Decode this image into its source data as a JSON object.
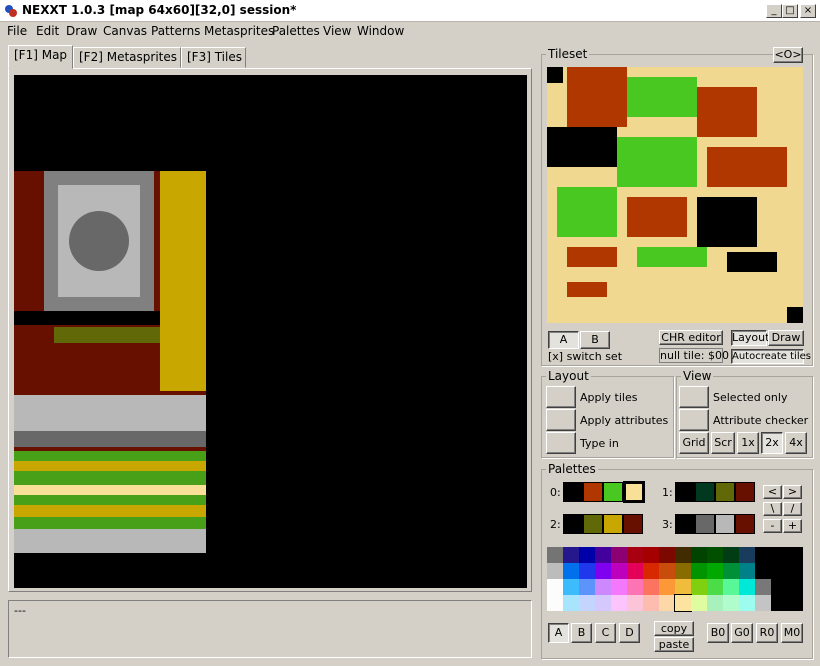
{
  "titlebar": {
    "title": "NEXXT 1.0.3  [map 64x60][32,0] session*",
    "minimize": "_",
    "maximize": "□",
    "close": "×"
  },
  "menu": [
    "File",
    "Edit",
    "Draw",
    "Canvas",
    "Patterns",
    "Metasprites",
    "Palettes",
    "View",
    "Window"
  ],
  "tabs": [
    "[F1] Map",
    "[F2] Metasprites",
    "[F3] Tiles"
  ],
  "status": {
    "text": "---"
  },
  "tileset": {
    "label": "Tileset",
    "toggle": "<O>",
    "bank_a": "A",
    "bank_b": "B",
    "switch_set": "[x] switch set",
    "chr_editor": "CHR editor",
    "null_tile": "null tile: $00",
    "layout": "Layout",
    "draw": "Draw",
    "autocreate": "Autocreate tiles"
  },
  "layout_group": {
    "label": "Layout",
    "apply_tiles": "Apply tiles",
    "apply_attributes": "Apply attributes",
    "type_in": "Type in"
  },
  "view_group": {
    "label": "View",
    "selected_only": "Selected only",
    "attribute_checker": "Attribute checker",
    "grid": "Grid",
    "scr": "Scr",
    "z1": "1x",
    "z2": "2x",
    "z4": "4x"
  },
  "palettes": {
    "label": "Palettes",
    "rows": [
      {
        "label": "0:",
        "colors": [
          "#000000",
          "#b03800",
          "#48c820",
          "#f8e098"
        ]
      },
      {
        "label": "1:",
        "colors": [
          "#000000",
          "#003820",
          "#606808",
          "#681000"
        ]
      },
      {
        "label": "2:",
        "colors": [
          "#000000",
          "#606808",
          "#c8a800",
          "#681000"
        ]
      },
      {
        "label": "3:",
        "colors": [
          "#000000",
          "#686868",
          "#b8b8b8",
          "#681000"
        ]
      }
    ],
    "nav": [
      "<",
      ">",
      "\\",
      "/",
      "-",
      "+"
    ],
    "subpal": [
      "A",
      "B",
      "C",
      "D"
    ],
    "copy": "copy",
    "paste": "paste",
    "regs": [
      "B0",
      "G0",
      "R0",
      "M0"
    ]
  },
  "master_palette": [
    [
      "#747474",
      "#24188c",
      "#0000a8",
      "#44009c",
      "#8c0074",
      "#a80010",
      "#a40000",
      "#7c0800",
      "#402c00",
      "#004400",
      "#005000",
      "#003c14",
      "#183c5c",
      "#000000",
      "#000000",
      "#000000"
    ],
    [
      "#bcbcbc",
      "#0070ec",
      "#2038ec",
      "#8000f0",
      "#bc00bc",
      "#e40058",
      "#d82800",
      "#c84c0c",
      "#886c00",
      "#009400",
      "#00a800",
      "#009038",
      "#008088",
      "#000000",
      "#000000",
      "#000000"
    ],
    [
      "#fcfcfc",
      "#3cbcfc",
      "#5c94fc",
      "#cc88fc",
      "#f478fc",
      "#fc74b4",
      "#fc7460",
      "#fc9838",
      "#f0bc3c",
      "#80d010",
      "#4cdc48",
      "#58f898",
      "#00e8d8",
      "#787878",
      "#000000",
      "#000000"
    ],
    [
      "#fcfcfc",
      "#a8e4fc",
      "#c4d4fc",
      "#d4c8fc",
      "#fcc4fc",
      "#fcc4d8",
      "#fcbcb0",
      "#fcd8a8",
      "#fce4a0",
      "#e0fca0",
      "#a8f0bc",
      "#b0fccc",
      "#9cfcf0",
      "#c4c4c4",
      "#000000",
      "#000000"
    ]
  ]
}
